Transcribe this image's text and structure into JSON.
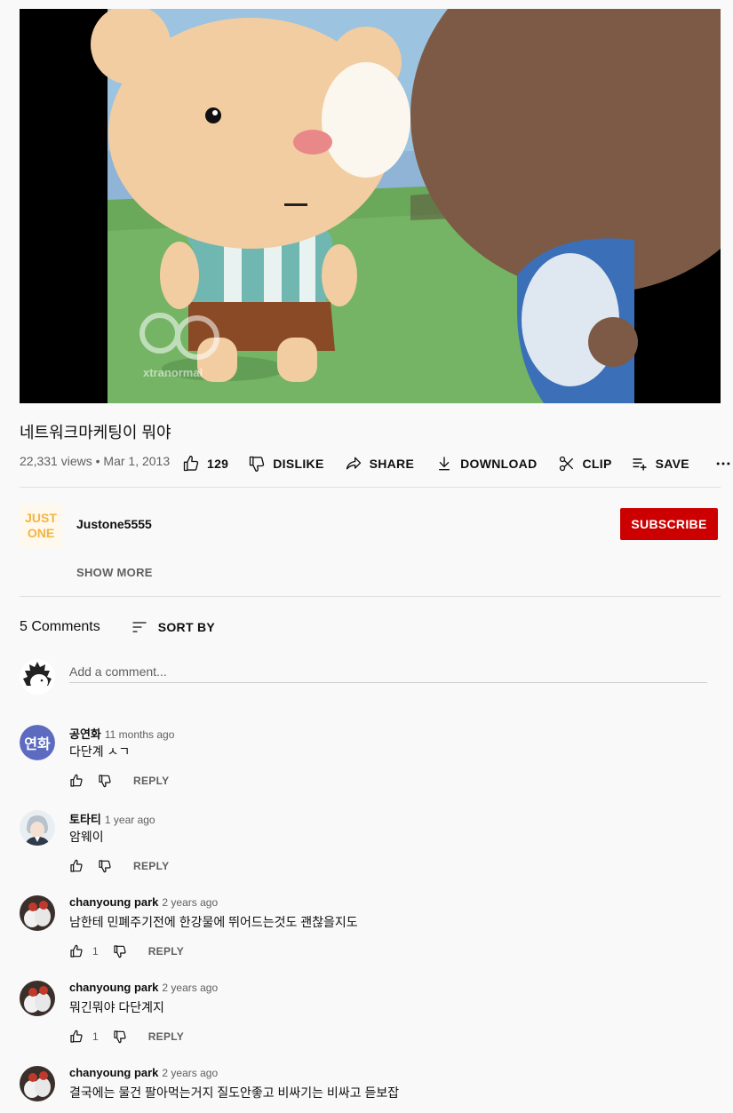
{
  "video": {
    "title": "네트워크마케팅이 뭐야",
    "views": "22,331 views",
    "separator": "•",
    "date": "Mar 1, 2013",
    "watermark": "xtranormal"
  },
  "actions": {
    "like_count": "129",
    "dislike_label": "DISLIKE",
    "share_label": "SHARE",
    "download_label": "DOWNLOAD",
    "clip_label": "CLIP",
    "save_label": "SAVE"
  },
  "channel": {
    "name": "Justone5555",
    "logo_text_top": "JUST",
    "logo_text_bottom": "ONE",
    "subscribe_label": "SUBSCRIBE",
    "show_more_label": "SHOW MORE"
  },
  "comments_section": {
    "count_label": "5 Comments",
    "sort_label": "SORT BY",
    "placeholder": "Add a comment..."
  },
  "comments": [
    {
      "author": "공연화",
      "time": "11 months ago",
      "text": "다단계 ㅅㄱ",
      "likes": "",
      "reply": "REPLY",
      "avatar_text": "연화",
      "avatar_color": "#5c6bc0"
    },
    {
      "author": "토타티",
      "time": "1 year ago",
      "text": "암웨이",
      "likes": "",
      "reply": "REPLY"
    },
    {
      "author": "chanyoung park",
      "time": "2 years ago",
      "text": "남한테 민폐주기전에 한강물에 뛰어드는것도 괜찮을지도",
      "likes": "1",
      "reply": "REPLY"
    },
    {
      "author": "chanyoung park",
      "time": "2 years ago",
      "text": "뭐긴뭐야 다단계지",
      "likes": "1",
      "reply": "REPLY"
    },
    {
      "author": "chanyoung park",
      "time": "2 years ago",
      "text": "결국에는 물건 팔아먹는거지 질도안좋고 비싸기는 비싸고 듣보잡",
      "likes": "",
      "reply": "REPLY"
    }
  ],
  "colors": {
    "background": "#f9f9f9",
    "subscribe": "#cc0000",
    "secondary_text": "#606060"
  }
}
